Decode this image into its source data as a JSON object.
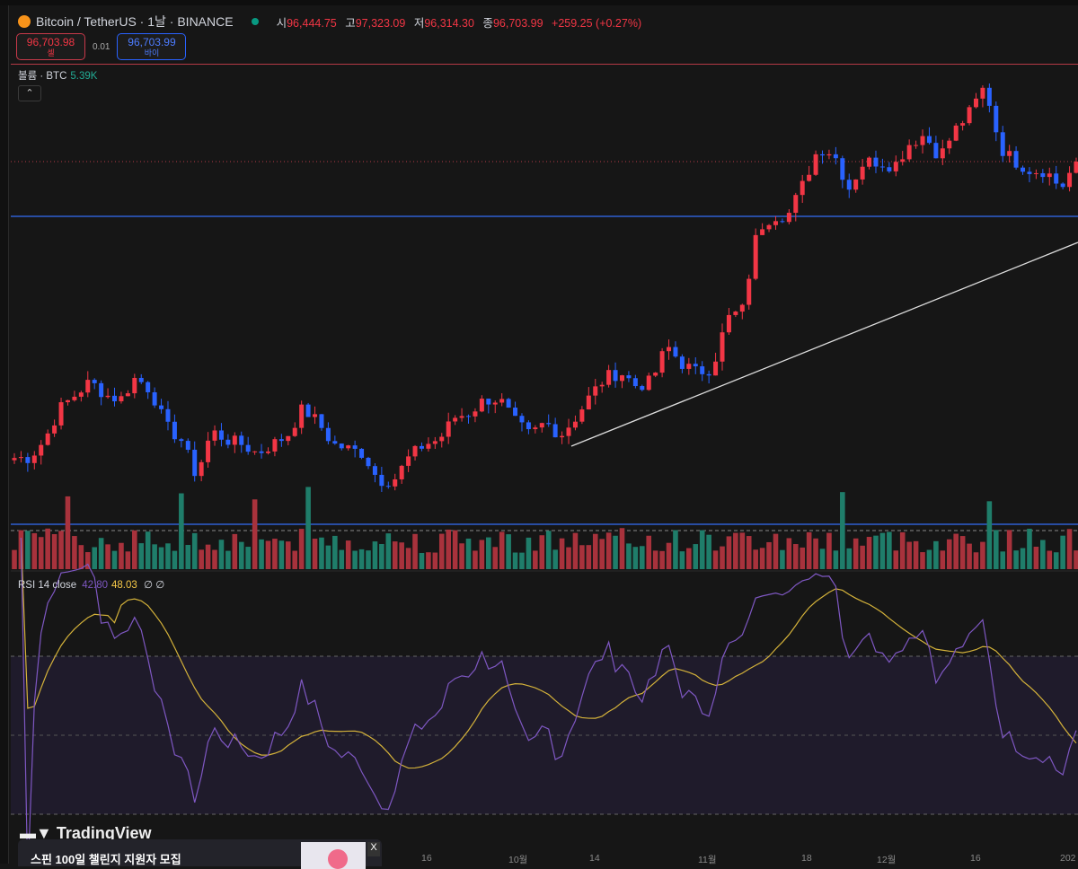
{
  "header": {
    "symbol": "Bitcoin / TetherUS · 1날 · BINANCE",
    "o_label": "시",
    "o": "96,444.75",
    "h_label": "고",
    "h": "97,323.09",
    "l_label": "저",
    "l": "96,314.30",
    "c_label": "종",
    "c": "96,703.99",
    "change": "+259.25 (+0.27%)"
  },
  "trade": {
    "sell_price": "96,703.98",
    "sell_label": "셀",
    "spread": "0.01",
    "buy_price": "96,703.99",
    "buy_label": "바이"
  },
  "volume": {
    "label": "볼륨 · BTC",
    "value": "5.39K"
  },
  "rsi": {
    "label": "RSI 14 close",
    "value": "42.80",
    "ma": "48.03",
    "extra1": "∅",
    "extra2": "∅"
  },
  "brand": "TradingView",
  "ad": {
    "text": "스핀 100일 챌린지 지원자 모집",
    "close": "X"
  },
  "x_axis": [
    "16",
    "10월",
    "14",
    "11월",
    "18",
    "12월",
    "16",
    "202"
  ],
  "colors": {
    "up": "#f23645",
    "down": "#2962ff",
    "vol_up": "#a8323c",
    "vol_down": "#1f7d6a",
    "rsi": "#7e57c2",
    "rsi_ma": "#d4b23a"
  },
  "chart_data": {
    "type": "candlestick",
    "title": "Bitcoin / TetherUS 1D",
    "current_price": 96703.99,
    "key_closes": [
      57434,
      57434,
      59814,
      63979,
      65764,
      67549,
      65764,
      65169,
      68144,
      66359,
      61599,
      59814,
      55054,
      61004,
      59814,
      59219,
      58029,
      59219,
      60409,
      63979,
      62194,
      59219,
      58624,
      58029,
      54459,
      54459,
      57434,
      59219,
      59814,
      62789,
      63384,
      65169,
      65169,
      62194,
      60409,
      62194,
      60409,
      62789,
      65764,
      68144,
      68739,
      66954,
      67549,
      72309,
      69929,
      68739,
      69334,
      75879,
      77069,
      87779,
      89564,
      89564,
      93729,
      98489,
      97894,
      93134,
      96704,
      96704,
      96109,
      99084,
      100274,
      97299,
      100869,
      103249,
      106819,
      98489,
      96704,
      95514,
      95514,
      93134,
      96704
    ]
  }
}
